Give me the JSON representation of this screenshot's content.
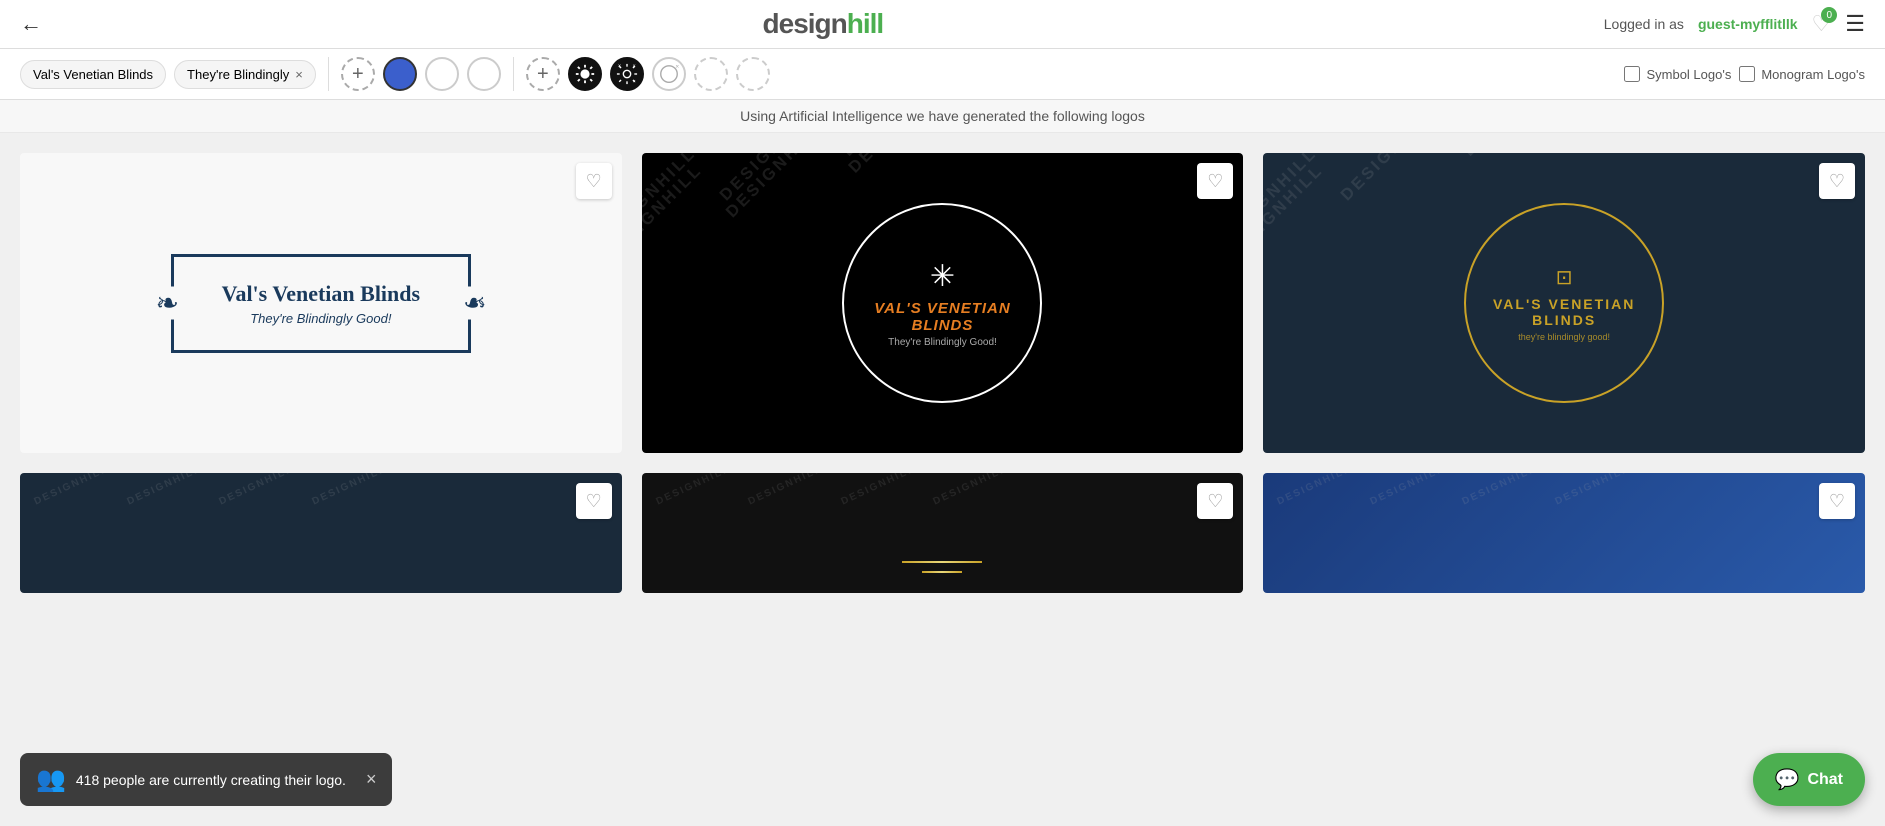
{
  "header": {
    "back_label": "←",
    "logo_design": "design",
    "logo_hill": "hill",
    "logged_in_label": "Logged in as",
    "username": "guest-myfflitllk",
    "heart_count": "0",
    "menu_label": "☰"
  },
  "toolbar": {
    "tag1_label": "Val's Venetian Blinds",
    "tag2_label": "They're Blindingly",
    "tag2_close": "×",
    "add_btn_label": "+",
    "colors": [
      {
        "value": "#3b5fcc",
        "selected": true
      },
      {
        "value": "#ffffff",
        "selected": false
      },
      {
        "value": "#ffffff",
        "selected": false
      }
    ],
    "add_symbol_label": "+",
    "symbol_logo_label": "Symbol Logo's",
    "monogram_logo_label": "Monogram Logo's"
  },
  "subtitle": "Using Artificial Intelligence we have generated the following logos",
  "logos": [
    {
      "id": 1,
      "title": "Val's Venetian Blinds",
      "subtitle": "They're Blindingly Good!",
      "bg": "#f8f8f8",
      "style": "frame",
      "favorited": false
    },
    {
      "id": 2,
      "title": "VAL'S VENETIAN BLINDS",
      "subtitle": "They're Blindingly Good!",
      "bg": "#000000",
      "style": "circle-dark",
      "favorited": false
    },
    {
      "id": 3,
      "title": "VAL'S VENETIAN BLINDS",
      "subtitle": "they're blindingly good!",
      "bg": "#1a2a3a",
      "style": "circle-gold",
      "favorited": false
    },
    {
      "id": 4,
      "title": "",
      "subtitle": "",
      "bg": "#1a2a3a",
      "style": "partial",
      "favorited": false
    },
    {
      "id": 5,
      "title": "",
      "subtitle": "",
      "bg": "#111111",
      "style": "partial",
      "favorited": false
    },
    {
      "id": 6,
      "title": "",
      "subtitle": "",
      "bg": "#1a3a7a",
      "style": "partial",
      "favorited": false
    }
  ],
  "notification": {
    "message": "418 people are currently creating their logo.",
    "icon": "👥",
    "close_label": "×"
  },
  "chat": {
    "label": "Chat",
    "icon": "💬"
  },
  "watermark": "DESIGNHILL"
}
